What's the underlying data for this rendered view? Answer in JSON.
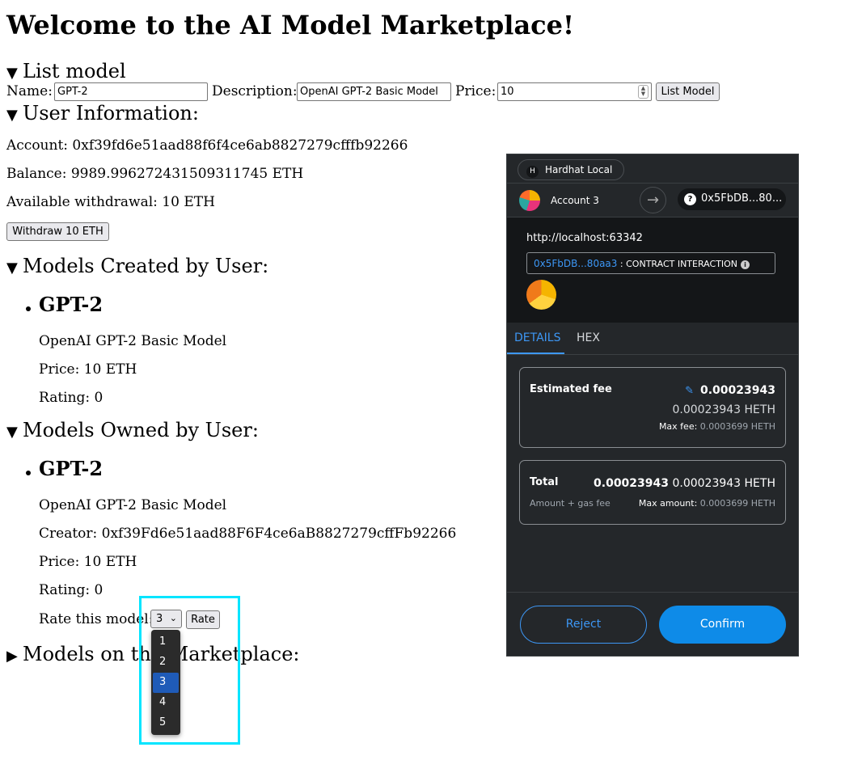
{
  "page": {
    "title": "Welcome to the AI Model Marketplace!",
    "list_model": {
      "summary": "List model",
      "name_label": "Name:",
      "name_value": "GPT-2",
      "description_label": "Description:",
      "description_value": "OpenAI GPT-2 Basic Model",
      "price_label": "Price:",
      "price_value": "10",
      "button": "List Model"
    },
    "user_info": {
      "summary": "User Information:",
      "account": "Account: 0xf39fd6e51aad88f6f4ce6ab8827279cfffb92266",
      "balance": "Balance: 9989.996272431509311745 ETH",
      "withdrawal": "Available withdrawal: 10 ETH",
      "withdraw_button": "Withdraw 10 ETH"
    },
    "created": {
      "summary": "Models Created by User:",
      "name": "GPT-2",
      "description": "OpenAI GPT-2 Basic Model",
      "price": "Price: 10 ETH",
      "rating": "Rating: 0"
    },
    "owned": {
      "summary": "Models Owned by User:",
      "name": "GPT-2",
      "description": "OpenAI GPT-2 Basic Model",
      "creator": "Creator: 0xf39Fd6e51aad88F6F4ce6aB8827279cffFb92266",
      "price": "Price: 10 ETH",
      "rating": "Rating: 0",
      "rate_label": "Rate this model:",
      "rate_selected": "3",
      "rate_options": [
        "1",
        "2",
        "3",
        "4",
        "5"
      ],
      "rate_button": "Rate"
    },
    "marketplace": {
      "summary": "Models on the Marketplace:"
    }
  },
  "metamask": {
    "network_badge": "H",
    "network": "Hardhat Local",
    "account": "Account 3",
    "destination_badge": "?",
    "destination": "0x5FbDB...80...",
    "origin": "http://localhost:63342",
    "contract_address": "0x5FbDB...80aa3",
    "contract_label": ": CONTRACT INTERACTION",
    "info_glyph": "i",
    "tabs": [
      "DETAILS",
      "HEX"
    ],
    "fee_label": "Estimated fee",
    "fee_value": "0.00023943",
    "fee_heth": "0.00023943 HETH",
    "max_fee_label": "Max fee:",
    "max_fee_value": "0.0003699 HETH",
    "total_label": "Total",
    "total_value": "0.00023943",
    "total_heth": "0.00023943 HETH",
    "amount_gas_label": "Amount + gas fee",
    "max_amount_label": "Max amount:",
    "max_amount_value": "0.0003699 HETH",
    "reject": "Reject",
    "confirm": "Confirm",
    "colors": {
      "accent": "#3d97f5",
      "confirm_bg": "#0e8be8",
      "panel_bg": "#24272a",
      "highlight_box": "#00e5ff"
    }
  }
}
